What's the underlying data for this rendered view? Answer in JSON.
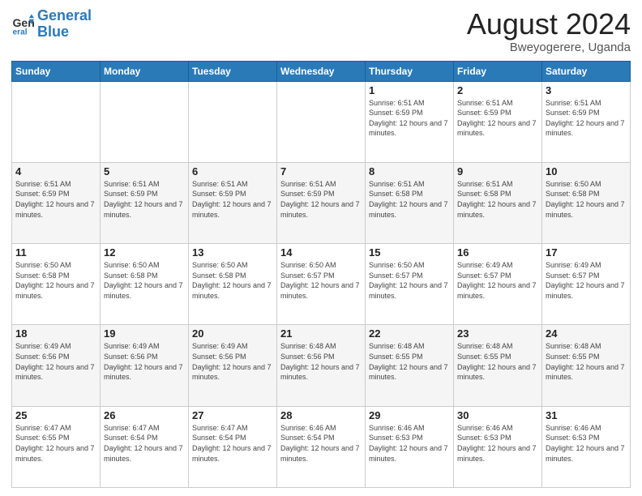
{
  "header": {
    "logo_general": "General",
    "logo_blue": "Blue",
    "main_title": "August 2024",
    "subtitle": "Bweyogerere, Uganda"
  },
  "weekdays": [
    "Sunday",
    "Monday",
    "Tuesday",
    "Wednesday",
    "Thursday",
    "Friday",
    "Saturday"
  ],
  "weeks": [
    [
      {
        "day": "",
        "info": ""
      },
      {
        "day": "",
        "info": ""
      },
      {
        "day": "",
        "info": ""
      },
      {
        "day": "",
        "info": ""
      },
      {
        "day": "1",
        "info": "Sunrise: 6:51 AM\nSunset: 6:59 PM\nDaylight: 12 hours and 7 minutes."
      },
      {
        "day": "2",
        "info": "Sunrise: 6:51 AM\nSunset: 6:59 PM\nDaylight: 12 hours and 7 minutes."
      },
      {
        "day": "3",
        "info": "Sunrise: 6:51 AM\nSunset: 6:59 PM\nDaylight: 12 hours and 7 minutes."
      }
    ],
    [
      {
        "day": "4",
        "info": "Sunrise: 6:51 AM\nSunset: 6:59 PM\nDaylight: 12 hours and 7 minutes."
      },
      {
        "day": "5",
        "info": "Sunrise: 6:51 AM\nSunset: 6:59 PM\nDaylight: 12 hours and 7 minutes."
      },
      {
        "day": "6",
        "info": "Sunrise: 6:51 AM\nSunset: 6:59 PM\nDaylight: 12 hours and 7 minutes."
      },
      {
        "day": "7",
        "info": "Sunrise: 6:51 AM\nSunset: 6:59 PM\nDaylight: 12 hours and 7 minutes."
      },
      {
        "day": "8",
        "info": "Sunrise: 6:51 AM\nSunset: 6:58 PM\nDaylight: 12 hours and 7 minutes."
      },
      {
        "day": "9",
        "info": "Sunrise: 6:51 AM\nSunset: 6:58 PM\nDaylight: 12 hours and 7 minutes."
      },
      {
        "day": "10",
        "info": "Sunrise: 6:50 AM\nSunset: 6:58 PM\nDaylight: 12 hours and 7 minutes."
      }
    ],
    [
      {
        "day": "11",
        "info": "Sunrise: 6:50 AM\nSunset: 6:58 PM\nDaylight: 12 hours and 7 minutes."
      },
      {
        "day": "12",
        "info": "Sunrise: 6:50 AM\nSunset: 6:58 PM\nDaylight: 12 hours and 7 minutes."
      },
      {
        "day": "13",
        "info": "Sunrise: 6:50 AM\nSunset: 6:58 PM\nDaylight: 12 hours and 7 minutes."
      },
      {
        "day": "14",
        "info": "Sunrise: 6:50 AM\nSunset: 6:57 PM\nDaylight: 12 hours and 7 minutes."
      },
      {
        "day": "15",
        "info": "Sunrise: 6:50 AM\nSunset: 6:57 PM\nDaylight: 12 hours and 7 minutes."
      },
      {
        "day": "16",
        "info": "Sunrise: 6:49 AM\nSunset: 6:57 PM\nDaylight: 12 hours and 7 minutes."
      },
      {
        "day": "17",
        "info": "Sunrise: 6:49 AM\nSunset: 6:57 PM\nDaylight: 12 hours and 7 minutes."
      }
    ],
    [
      {
        "day": "18",
        "info": "Sunrise: 6:49 AM\nSunset: 6:56 PM\nDaylight: 12 hours and 7 minutes."
      },
      {
        "day": "19",
        "info": "Sunrise: 6:49 AM\nSunset: 6:56 PM\nDaylight: 12 hours and 7 minutes."
      },
      {
        "day": "20",
        "info": "Sunrise: 6:49 AM\nSunset: 6:56 PM\nDaylight: 12 hours and 7 minutes."
      },
      {
        "day": "21",
        "info": "Sunrise: 6:48 AM\nSunset: 6:56 PM\nDaylight: 12 hours and 7 minutes."
      },
      {
        "day": "22",
        "info": "Sunrise: 6:48 AM\nSunset: 6:55 PM\nDaylight: 12 hours and 7 minutes."
      },
      {
        "day": "23",
        "info": "Sunrise: 6:48 AM\nSunset: 6:55 PM\nDaylight: 12 hours and 7 minutes."
      },
      {
        "day": "24",
        "info": "Sunrise: 6:48 AM\nSunset: 6:55 PM\nDaylight: 12 hours and 7 minutes."
      }
    ],
    [
      {
        "day": "25",
        "info": "Sunrise: 6:47 AM\nSunset: 6:55 PM\nDaylight: 12 hours and 7 minutes."
      },
      {
        "day": "26",
        "info": "Sunrise: 6:47 AM\nSunset: 6:54 PM\nDaylight: 12 hours and 7 minutes."
      },
      {
        "day": "27",
        "info": "Sunrise: 6:47 AM\nSunset: 6:54 PM\nDaylight: 12 hours and 7 minutes."
      },
      {
        "day": "28",
        "info": "Sunrise: 6:46 AM\nSunset: 6:54 PM\nDaylight: 12 hours and 7 minutes."
      },
      {
        "day": "29",
        "info": "Sunrise: 6:46 AM\nSunset: 6:53 PM\nDaylight: 12 hours and 7 minutes."
      },
      {
        "day": "30",
        "info": "Sunrise: 6:46 AM\nSunset: 6:53 PM\nDaylight: 12 hours and 7 minutes."
      },
      {
        "day": "31",
        "info": "Sunrise: 6:46 AM\nSunset: 6:53 PM\nDaylight: 12 hours and 7 minutes."
      }
    ]
  ]
}
